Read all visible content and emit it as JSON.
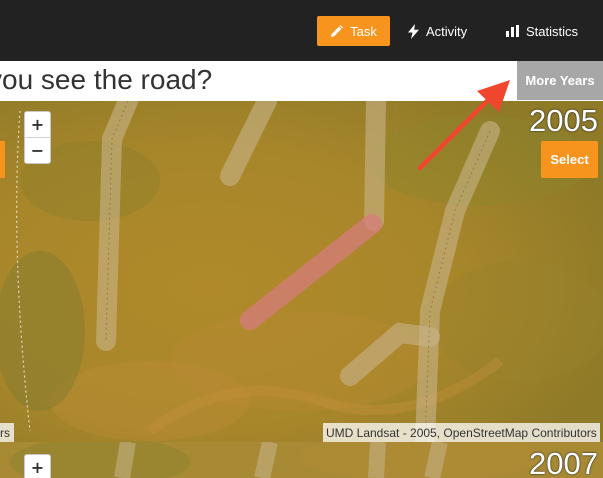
{
  "nav": {
    "task_label": "Task",
    "activity_label": "Activity",
    "statistics_label": "Statistics",
    "accent_color": "#f7941d"
  },
  "question": {
    "text": "you see the road?"
  },
  "more_years": {
    "label": "More Years"
  },
  "map_main": {
    "year": "2005",
    "zoom_in": "+",
    "zoom_out": "−",
    "select_label": "Select",
    "attribution": "UMD Landsat - 2005, OpenStreetMap Contributors",
    "attribution_left_fragment": "rs"
  },
  "map_next": {
    "year": "2007",
    "zoom_in": "+"
  }
}
